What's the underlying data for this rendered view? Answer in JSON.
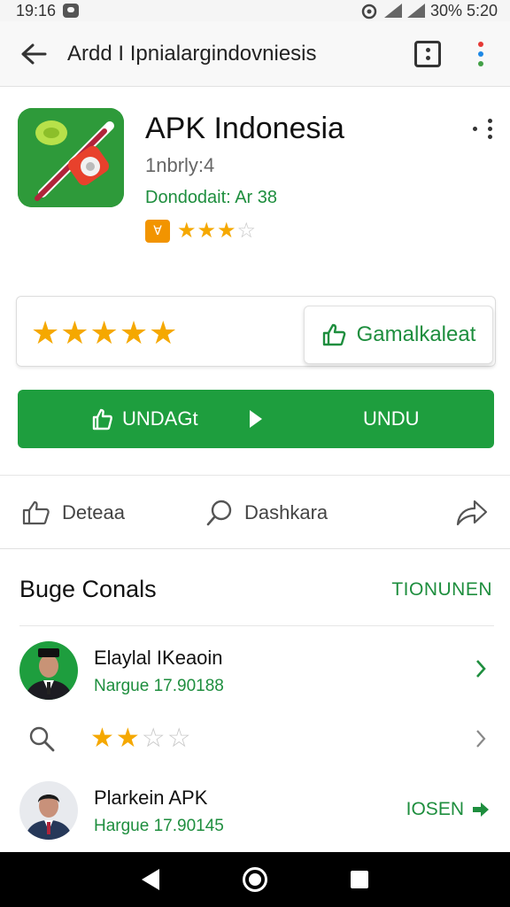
{
  "status_bar": {
    "time": "19:16",
    "right_text": "30% 5:20"
  },
  "app_bar": {
    "title": "Ardd I Ipnialargindovniesis"
  },
  "app": {
    "name": "APK Indonesia",
    "subtitle": "1nbrly:4",
    "downloads": "Dondodait: Ar 38",
    "badge": "Ɐ",
    "rating_stars": "★★★",
    "rating_stars_empty": "☆"
  },
  "rate_card": {
    "stars": "★★★★★",
    "button_label": "Gamalkaleat"
  },
  "install_button": {
    "left_label": "UNDAGt",
    "right_label": "UNDU"
  },
  "actions": {
    "first": "Deteaa",
    "second": "Dashkara"
  },
  "section": {
    "title": "Buge Conals",
    "link": "TIONUNEN"
  },
  "reviews": [
    {
      "name": "Elaylal IKeaoin",
      "meta": "Nargue 17.90188"
    },
    {
      "name": "Plarkein APK",
      "meta": "Hargue 17.90145",
      "action": "IOSEN"
    }
  ],
  "review_stars": {
    "filled": "★★",
    "empty": "☆☆"
  },
  "colors": {
    "accent_green": "#1e9e3e",
    "star": "#f5a800",
    "badge_orange": "#f29400"
  }
}
